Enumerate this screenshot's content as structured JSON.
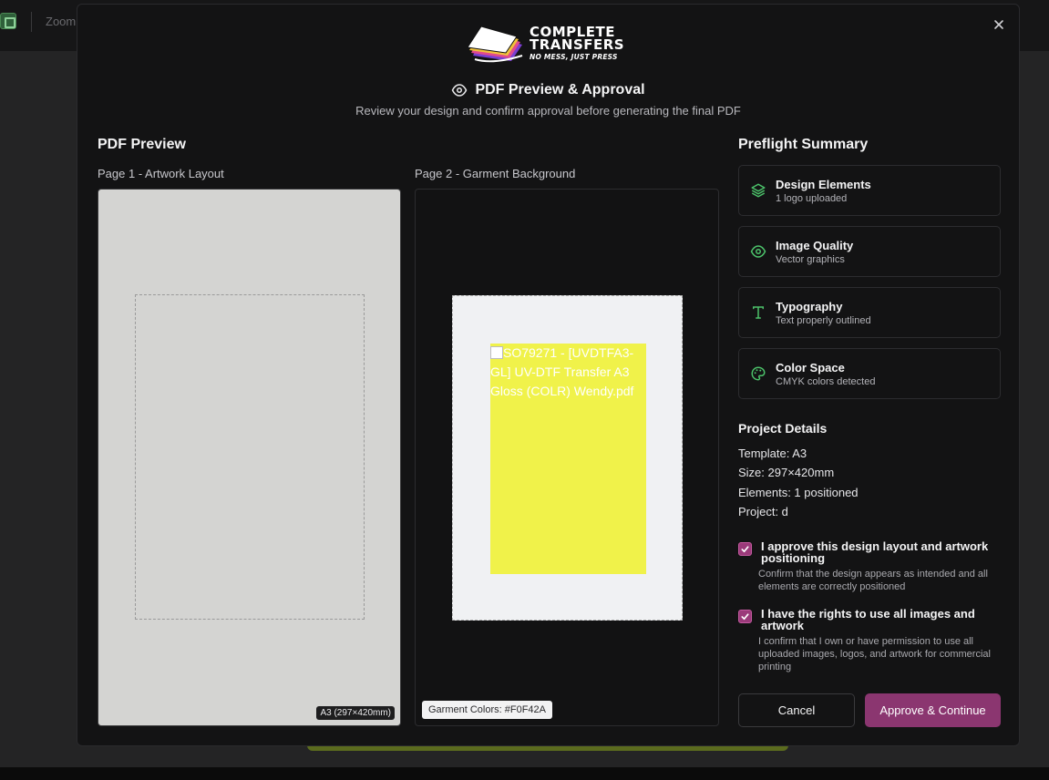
{
  "background": {
    "app_label": "Zoom"
  },
  "modal": {
    "logo": {
      "line1": "COMPLETE",
      "line2": "TRANSFERS",
      "tagline": "NO MESS, JUST PRESS"
    },
    "title": "PDF Preview & Approval",
    "subtitle": "Review your design and confirm approval before generating the final PDF",
    "preview": {
      "heading": "PDF Preview",
      "page1_label": "Page 1 - Artwork Layout",
      "page1_size_badge": "A3 (297×420mm)",
      "page2_label": "Page 2 - Garment Background",
      "garment_image_alt": "SO79271 - [UVDTFA3-GL] UV-DTF Transfer A3 Gloss (COLR) Wendy.pdf",
      "garment_colors": "Garment Colors: #F0F42A",
      "garment_fill": "#F0F24A"
    },
    "preflight": {
      "heading": "Preflight Summary",
      "items": [
        {
          "icon": "layers-icon",
          "title": "Design Elements",
          "subtitle": "1 logo uploaded"
        },
        {
          "icon": "eye-icon",
          "title": "Image Quality",
          "subtitle": "Vector graphics"
        },
        {
          "icon": "type-icon",
          "title": "Typography",
          "subtitle": "Text properly outlined"
        },
        {
          "icon": "palette-icon",
          "title": "Color Space",
          "subtitle": "CMYK colors detected"
        }
      ]
    },
    "project": {
      "heading": "Project Details",
      "template": "Template: A3",
      "size": "Size: 297×420mm",
      "elements": "Elements: 1 positioned",
      "project": "Project: d"
    },
    "approvals": [
      {
        "checked": true,
        "label": "I approve this design layout and artwork positioning",
        "desc": "Confirm that the design appears as intended and all elements are correctly positioned"
      },
      {
        "checked": true,
        "label": "I have the rights to use all images and artwork",
        "desc": "I confirm that I own or have permission to use all uploaded images, logos, and artwork for commercial printing"
      }
    ],
    "buttons": {
      "cancel": "Cancel",
      "approve": "Approve & Continue"
    },
    "colors": {
      "accent": "#8B3670",
      "success_icon": "#4CC26A"
    }
  }
}
